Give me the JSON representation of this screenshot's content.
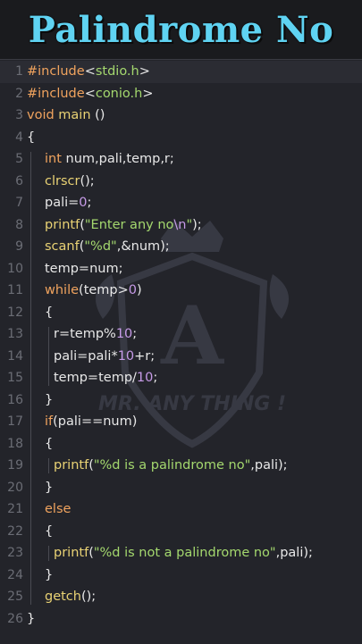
{
  "title": "Palindrome No",
  "watermark_text": "MR. ANY THING !",
  "watermark_letter": "A",
  "colors": {
    "title": "#5fd3f2",
    "background": "#23242a",
    "keyword": "#f0a35e",
    "function": "#e9d274",
    "string": "#a4d86e",
    "number": "#c79be8",
    "line_number": "#6b6d75"
  },
  "lines": [
    {
      "n": "1",
      "indent": 0,
      "tokens": [
        [
          "inc",
          "#include"
        ],
        [
          "op",
          "<"
        ],
        [
          "hdr",
          "stdio.h"
        ],
        [
          "op",
          ">"
        ]
      ]
    },
    {
      "n": "2",
      "indent": 0,
      "tokens": [
        [
          "inc",
          "#include"
        ],
        [
          "op",
          "<"
        ],
        [
          "hdr",
          "conio.h"
        ],
        [
          "op",
          ">"
        ]
      ]
    },
    {
      "n": "3",
      "indent": 0,
      "tokens": [
        [
          "kw",
          "void"
        ],
        [
          "op",
          " "
        ],
        [
          "fn",
          "main"
        ],
        [
          "op",
          " ()"
        ]
      ]
    },
    {
      "n": "4",
      "indent": 0,
      "tokens": [
        [
          "op",
          "{"
        ]
      ]
    },
    {
      "n": "5",
      "indent": 1,
      "tokens": [
        [
          "kw",
          "int"
        ],
        [
          "op",
          " num,pali,temp,r;"
        ]
      ]
    },
    {
      "n": "6",
      "indent": 1,
      "tokens": [
        [
          "fn",
          "clrscr"
        ],
        [
          "op",
          "();"
        ]
      ]
    },
    {
      "n": "7",
      "indent": 1,
      "tokens": [
        [
          "op",
          "pali="
        ],
        [
          "num",
          "0"
        ],
        [
          "op",
          ";"
        ]
      ]
    },
    {
      "n": "8",
      "indent": 1,
      "tokens": [
        [
          "fn",
          "printf"
        ],
        [
          "op",
          "("
        ],
        [
          "str",
          "\"Enter any no"
        ],
        [
          "esc",
          "\\n"
        ],
        [
          "str",
          "\""
        ],
        [
          "op",
          ");"
        ]
      ]
    },
    {
      "n": "9",
      "indent": 1,
      "tokens": [
        [
          "fn",
          "scanf"
        ],
        [
          "op",
          "("
        ],
        [
          "str",
          "\"%d\""
        ],
        [
          "op",
          ",&num);"
        ]
      ]
    },
    {
      "n": "10",
      "indent": 1,
      "tokens": [
        [
          "op",
          "temp=num;"
        ]
      ]
    },
    {
      "n": "11",
      "indent": 1,
      "tokens": [
        [
          "kw",
          "while"
        ],
        [
          "op",
          "(temp>"
        ],
        [
          "num",
          "0"
        ],
        [
          "op",
          ")"
        ]
      ]
    },
    {
      "n": "12",
      "indent": 1,
      "tokens": [
        [
          "op",
          "{"
        ]
      ]
    },
    {
      "n": "13",
      "indent": 2,
      "tokens": [
        [
          "op",
          "r=temp%"
        ],
        [
          "num",
          "10"
        ],
        [
          "op",
          ";"
        ]
      ]
    },
    {
      "n": "14",
      "indent": 2,
      "tokens": [
        [
          "op",
          "pali=pali*"
        ],
        [
          "num",
          "10"
        ],
        [
          "op",
          "+r;"
        ]
      ]
    },
    {
      "n": "15",
      "indent": 2,
      "tokens": [
        [
          "op",
          "temp=temp/"
        ],
        [
          "num",
          "10"
        ],
        [
          "op",
          ";"
        ]
      ]
    },
    {
      "n": "16",
      "indent": 1,
      "tokens": [
        [
          "op",
          "}"
        ]
      ]
    },
    {
      "n": "17",
      "indent": 1,
      "tokens": [
        [
          "kw",
          "if"
        ],
        [
          "op",
          "(pali==num)"
        ]
      ]
    },
    {
      "n": "18",
      "indent": 1,
      "tokens": [
        [
          "op",
          "{"
        ]
      ]
    },
    {
      "n": "19",
      "indent": 2,
      "tokens": [
        [
          "fn",
          "printf"
        ],
        [
          "op",
          "("
        ],
        [
          "str",
          "\"%d is a palindrome no\""
        ],
        [
          "op",
          ",pali);"
        ]
      ]
    },
    {
      "n": "20",
      "indent": 1,
      "tokens": [
        [
          "op",
          "}"
        ]
      ]
    },
    {
      "n": "21",
      "indent": 1,
      "tokens": [
        [
          "kw",
          "else"
        ]
      ]
    },
    {
      "n": "22",
      "indent": 1,
      "tokens": [
        [
          "op",
          "{"
        ]
      ]
    },
    {
      "n": "23",
      "indent": 2,
      "tokens": [
        [
          "fn",
          "printf"
        ],
        [
          "op",
          "("
        ],
        [
          "str",
          "\"%d is not a palindrome no\""
        ],
        [
          "op",
          ",pali);"
        ]
      ]
    },
    {
      "n": "24",
      "indent": 1,
      "tokens": [
        [
          "op",
          "}"
        ]
      ]
    },
    {
      "n": "25",
      "indent": 1,
      "tokens": [
        [
          "fn",
          "getch"
        ],
        [
          "op",
          "();"
        ]
      ]
    },
    {
      "n": "26",
      "indent": 0,
      "tokens": [
        [
          "op",
          "}"
        ]
      ]
    }
  ]
}
